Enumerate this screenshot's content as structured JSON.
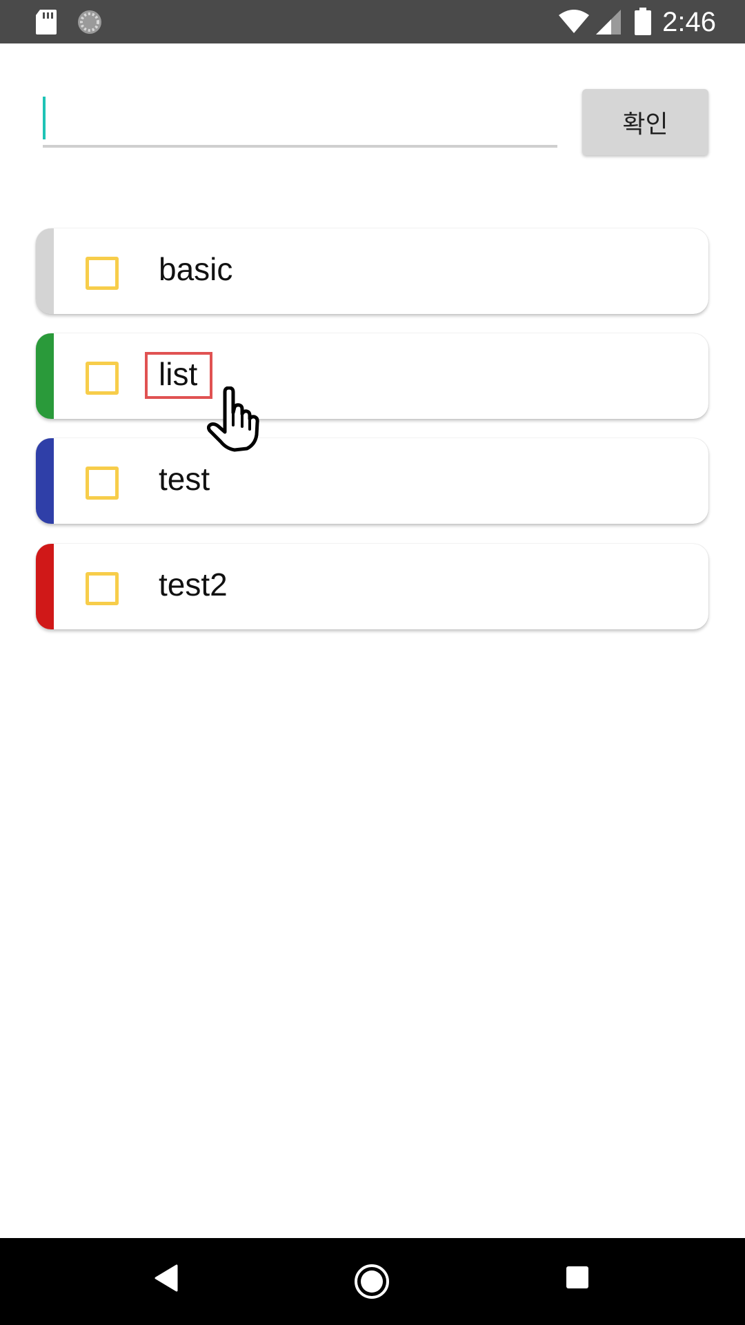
{
  "status_bar": {
    "time": "2:46",
    "icons": [
      "sd-card-icon",
      "sync-icon",
      "wifi-icon",
      "signal-icon",
      "battery-icon"
    ]
  },
  "input": {
    "value": "",
    "placeholder": ""
  },
  "confirm_button": {
    "label": "확인"
  },
  "list": {
    "items": [
      {
        "label": "basic",
        "color": "#d4d4d4",
        "checked": false
      },
      {
        "label": "list",
        "color": "#2a9a3a",
        "checked": false
      },
      {
        "label": "test",
        "color": "#2f3fa8",
        "checked": false
      },
      {
        "label": "test2",
        "color": "#d01818",
        "checked": false
      }
    ]
  },
  "colors": {
    "accent_caret": "#1ec3b6",
    "checkbox": "#f7cd4a",
    "highlight": "#e05252"
  },
  "nav_bar": {
    "icons": [
      "back-icon",
      "home-icon",
      "recents-icon"
    ]
  }
}
